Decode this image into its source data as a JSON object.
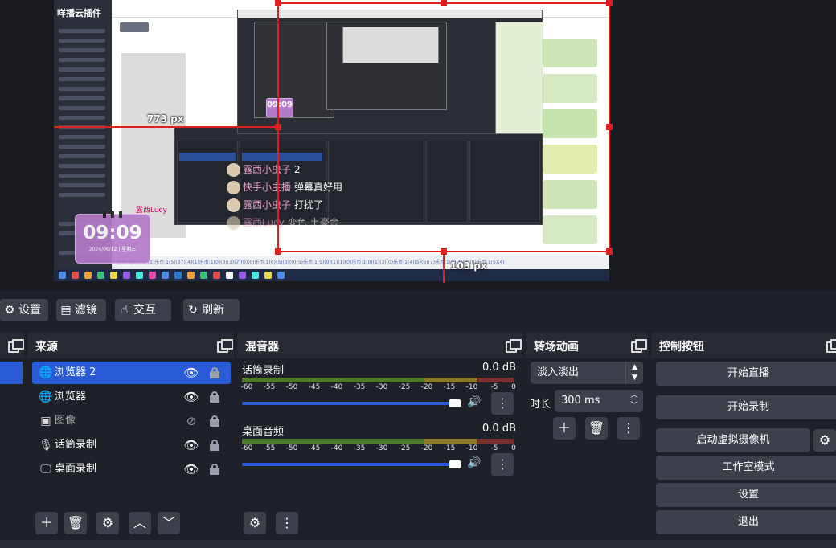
{
  "preview": {
    "web_logo": "咩播云插件",
    "footer_text": "乐币:1(2)(72)(3)乐币:1(5)(37)(4)(1)乐币:1(0)(3)(3)(7)(0)(0)乐币:1(6)(5)(3)(0)(5)乐币:1(5)(0)(1)(1)(0)乐币:1(0)(1)(3)(0)乐币:1(4)(5)(6)(7)乐币:1(0)(1)(3)(0)乐币:1(5)(4)",
    "clock": {
      "time": "09:09",
      "date": "2024/06/12 | 星期三"
    },
    "clock_small": {
      "time": "09:09"
    },
    "measure_left": "773 px",
    "measure_bottom": "103 px",
    "chat": [
      {
        "user": "露西小虫子",
        "message": "2"
      },
      {
        "user": "快手小主播",
        "message": "弹幕真好用"
      },
      {
        "user": "露西小虫子",
        "message": "打扰了"
      },
      {
        "user": "露西Lucy",
        "message": "变色 土豪金"
      }
    ],
    "web_side_label": "露西Lucy"
  },
  "toolbar": {
    "settings": "设置",
    "filters": "滤镜",
    "interact": "交互",
    "refresh": "刷新"
  },
  "sources": {
    "title": "来源",
    "items": [
      {
        "label": "浏览器 2",
        "icon": "globe-icon",
        "visible": true,
        "selected": true
      },
      {
        "label": "浏览器",
        "icon": "globe-icon",
        "visible": true,
        "selected": false
      },
      {
        "label": "图像",
        "icon": "image-icon",
        "visible": false,
        "selected": false
      },
      {
        "label": "话筒录制",
        "icon": "microphone-icon",
        "visible": true,
        "selected": false
      },
      {
        "label": "桌面录制",
        "icon": "monitor-icon",
        "visible": true,
        "selected": false
      }
    ]
  },
  "mixer": {
    "title": "混音器",
    "channels": [
      {
        "name": "话筒录制",
        "db": "0.0 dB",
        "volume": 1.0
      },
      {
        "name": "桌面音频",
        "db": "0.0 dB",
        "volume": 1.0
      }
    ],
    "ticks": [
      "-60",
      "-55",
      "-50",
      "-45",
      "-40",
      "-35",
      "-30",
      "-25",
      "-20",
      "-15",
      "-10",
      "-5",
      "0"
    ]
  },
  "transitions": {
    "title": "转场动画",
    "selected": "淡入淡出",
    "duration_label": "时长",
    "duration_value": "300 ms"
  },
  "controls": {
    "title": "控制按钮",
    "start_stream": "开始直播",
    "start_record": "开始录制",
    "virtual_cam": "启动虚拟摄像机",
    "studio_mode": "工作室模式",
    "settings": "设置",
    "exit": "退出"
  },
  "colors": {
    "selection_blue": "#2a5bd7",
    "guide_red": "#e02020",
    "button_grey": "#3c404b",
    "dock_bg": "#272a33"
  }
}
